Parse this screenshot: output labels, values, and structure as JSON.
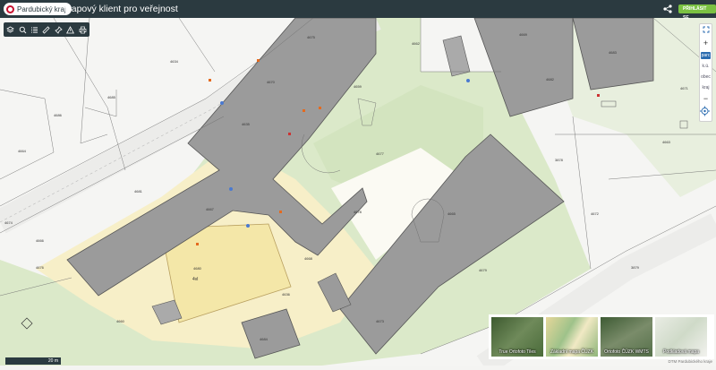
{
  "header": {
    "logo_text": "Pardubický kraj",
    "title": "Mapový klient pro veřejnost",
    "login_label": "PŘIHLÁSIT SE"
  },
  "toolbar": {
    "icons": [
      "layers-icon",
      "search-icon",
      "legend-list-icon",
      "measure-ruler-icon",
      "pin-icon",
      "warning-icon",
      "print-icon"
    ]
  },
  "map_controls": {
    "zoom_in": "+",
    "zoom_out": "−",
    "active_label": "parc",
    "labels": [
      "k.ú.",
      "obec",
      "kraj"
    ]
  },
  "map_labels": {
    "parcels": [
      "4675",
      "4659",
      "4670",
      "4680",
      "4679",
      "4676",
      "4677",
      "4682",
      "4683",
      "4684",
      "4685",
      "4686",
      "4681",
      "4665",
      "4663",
      "4664",
      "4673",
      "4671",
      "4669",
      "4672",
      "4668",
      "4667",
      "4666",
      "4674",
      "4678",
      "3878",
      "3879",
      "4662",
      "4634",
      "4635",
      "4636",
      "4660"
    ],
    "parcel_map": "4vl"
  },
  "scale": {
    "label": "20 m"
  },
  "basemaps": [
    {
      "label": "True Ortofoto Tiles",
      "color_a": "#3d5a2f",
      "color_b": "#6f8a5a"
    },
    {
      "label": "Základní mapa ČÚZK",
      "color_a": "#e6d79a",
      "color_b": "#9ec28a"
    },
    {
      "label": "Ortofoto ČÚZK WMTS",
      "color_a": "#3e5b34",
      "color_b": "#7a8c6a"
    },
    {
      "label": "Podkladová mapa",
      "color_a": "#e9ece4",
      "color_b": "#cfdac8"
    }
  ],
  "attribution": "DTM Pardubického kraje",
  "colors": {
    "header_bg": "#2b3a40",
    "green_area": "#d9e8c8",
    "yellow_area": "#f7eec2",
    "building": "#9c9c9c",
    "login": "#7bc142"
  }
}
